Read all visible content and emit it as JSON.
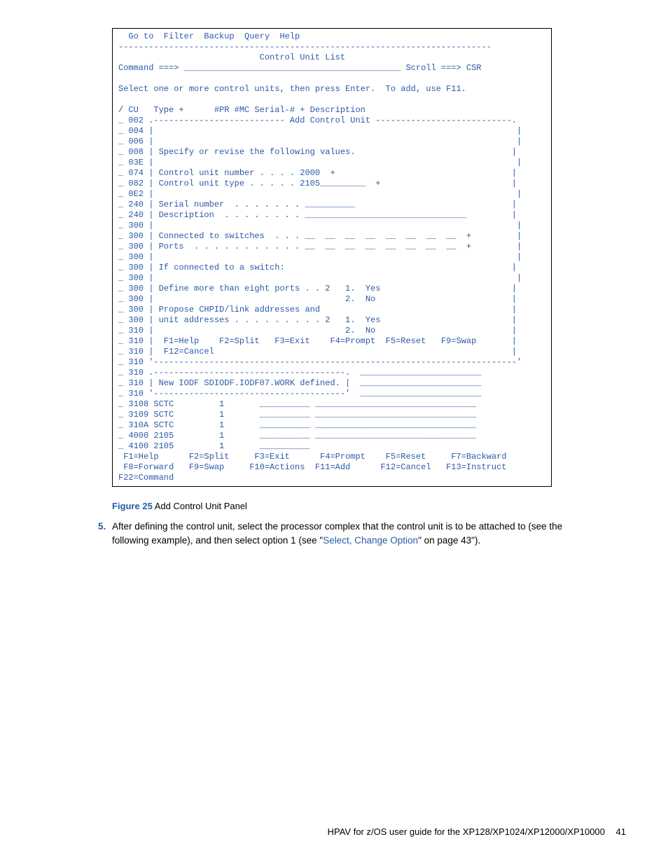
{
  "terminal": {
    "lines": [
      "  Go to  Filter  Backup  Query  Help",
      "--------------------------------------------------------------------------",
      "                            Control Unit List",
      "Command ===> ___________________________________________ Scroll ===> CSR",
      "",
      "Select one or more control units, then press Enter.  To add, use F11.",
      "",
      "/ CU   Type +      #PR #MC Serial-# + Description",
      "_ 002 .-------------------------- Add Control Unit ---------------------------.",
      "_ 004 |                                                                        |",
      "_ 006 |                                                                        |",
      "_ 008 | Specify or revise the following values.                               |",
      "_ 03E |                                                                        |",
      "_ 074 | Control unit number . . . . 2000  +                                   |",
      "_ 082 | Control unit type . . . . . 2105_________  +                          |",
      "_ 0E2 |                                                                        |",
      "_ 240 | Serial number  . . . . . . . __________                               |",
      "_ 240 | Description  . . . . . . . . ________________________________         |",
      "_ 300 |                                                                        |",
      "_ 300 | Connected to switches  . . . __  __  __  __  __  __  __  __  +         |",
      "_ 300 | Ports  . . . . . . . . . . . __  __  __  __  __  __  __  __  +         |",
      "_ 300 |                                                                        |",
      "_ 300 | If connected to a switch:                                             |",
      "_ 300 |                                                                        |",
      "_ 300 | Define more than eight ports . . 2   1.  Yes                          |",
      "_ 300 |                                      2.  No                           |",
      "_ 300 | Propose CHPID/link addresses and                                      |",
      "_ 300 | unit addresses . . . . . . . . . 2   1.  Yes                          |",
      "_ 310 |                                      2.  No                           |",
      "_ 310 |  F1=Help    F2=Split   F3=Exit    F4=Prompt  F5=Reset   F9=Swap       |",
      "_ 310 |  F12=Cancel                                                           |",
      "_ 310 '------------------------------------------------------------------------'",
      "_ 310 .--------------------------------------.  ________________________",
      "_ 310 | New IODF SDIODF.IODF07.WORK defined. |  ________________________",
      "_ 310 '--------------------------------------'  ________________________",
      "_ 3108 SCTC         1       __________ ________________________________",
      "_ 3109 SCTC         1       __________ ________________________________",
      "_ 310A SCTC         1       __________ ________________________________",
      "_ 4000 2105         1       __________ ________________________________",
      "_ 4100 2105         1       __________",
      " F1=Help      F2=Split     F3=Exit      F4=Prompt    F5=Reset     F7=Backward",
      " F8=Forward   F9=Swap     F10=Actions  F11=Add      F12=Cancel   F13=Instruct",
      "F22=Command"
    ]
  },
  "figure": {
    "label": "Figure 25",
    "title": "Add Control Unit Panel"
  },
  "step": {
    "number": "5.",
    "text_before": "After defining the control unit, select the processor complex that the control unit is to be attached to (see the following example), and then select option 1 (see \"",
    "link_text": "Select, Change Option",
    "text_after": "\" on page 43\")."
  },
  "footer": {
    "doc_title": "HPAV for z/OS user guide for the XP128/XP1024/XP12000/XP10000",
    "page": "41"
  }
}
